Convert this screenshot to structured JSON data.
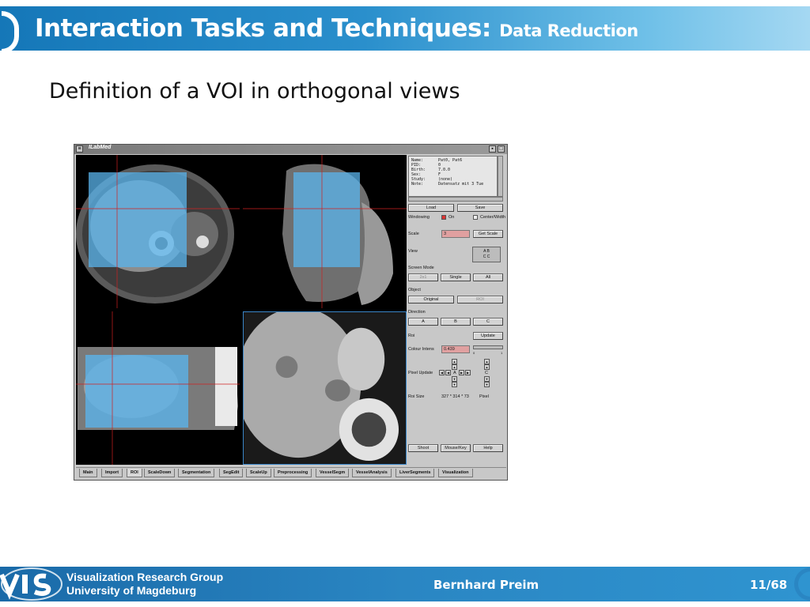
{
  "header": {
    "title": "Interaction Tasks and Techniques:",
    "subtitle": "Data Reduction"
  },
  "slide": {
    "heading": "Definition of a VOI in orthogonal views"
  },
  "app": {
    "window_title": "ILabMed",
    "info": [
      {
        "key": "Name:",
        "value": "Pat0, Pat6"
      },
      {
        "key": "PID:",
        "value": "0"
      },
      {
        "key": "Birth:",
        "value": "7.0.0"
      },
      {
        "key": "Sex:",
        "value": "F"
      },
      {
        "key": "Study:",
        "value": "(none)"
      },
      {
        "key": "Note:",
        "value": "Datensatz mit 3 Tue"
      }
    ],
    "buttons": {
      "load": "Load",
      "save": "Save",
      "get_scale": "Get Scale",
      "mode_2x1": "2x1",
      "single": "Single",
      "all": "All",
      "original": "Original",
      "roi_obj": "ROI",
      "dir_a": "A",
      "dir_b": "B",
      "dir_c": "C",
      "update": "Update",
      "shoot": "Shoot",
      "mousekey": "Mouse/Key",
      "help": "Help"
    },
    "labels": {
      "windowing": "Windowing",
      "on": "On",
      "center_width": "Center/Width",
      "scale": "Scale",
      "view": "View",
      "screen_mode": "Screen Mode",
      "object": "Object",
      "direction": "Direction",
      "roi": "Roi",
      "colour_intens": "Colour Intens",
      "pixel_update": "Pixel Update",
      "roi_size": "Roi Size",
      "roi_size_value": "327 * 314 * 73",
      "pixel": "Pixel",
      "view_grid_1": "A B",
      "view_grid_2": "C C",
      "pixel_center_a": "A",
      "pixel_center_c": "C",
      "slider_min": "0",
      "slider_max": "1"
    },
    "inputs": {
      "scale": "3",
      "colour_intens": "0.439"
    },
    "windowing_on": true,
    "center_width_on": false,
    "tabs": [
      "Main",
      "Import",
      "ROI",
      "ScaleDown",
      "Segmentation",
      "SegEdit",
      "ScaleUp",
      "Preprocessing",
      "VesselSegm",
      "VesselAnalysis",
      "LiverSegments",
      "Visualization"
    ],
    "active_tab": "ROI"
  },
  "footer": {
    "org_line1": "Visualization Research Group",
    "org_line2": "University of Magdeburg",
    "author": "Bernhard Preim",
    "page": "11/68"
  },
  "colors": {
    "header_blue": "#1577b8",
    "roi_overlay": "#5ab4ec",
    "footer_blue": "#2a86c3"
  }
}
